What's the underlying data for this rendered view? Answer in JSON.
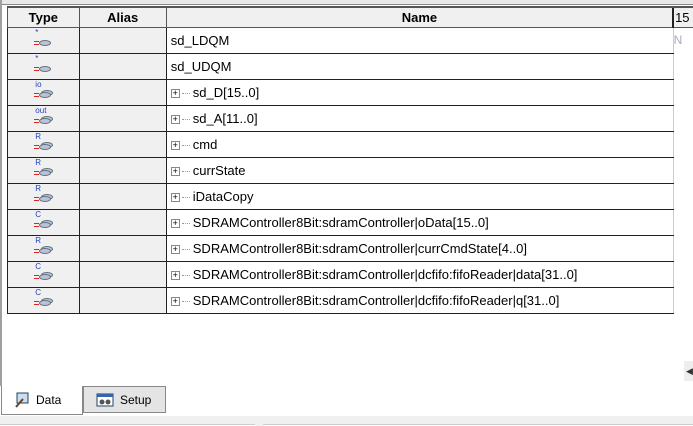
{
  "columns": {
    "type": "Type",
    "alias": "Alias",
    "name": "Name",
    "extra": "15"
  },
  "rows": [
    {
      "type_icon": "*",
      "icon_name": "single-node-icon",
      "name": "sd_LDQM",
      "expandable": false,
      "extra": "N"
    },
    {
      "type_icon": "*",
      "icon_name": "single-node-icon",
      "name": "sd_UDQM",
      "expandable": false,
      "extra": ""
    },
    {
      "type_icon": "io",
      "icon_name": "io-bus-icon",
      "name": "sd_D[15..0]",
      "expandable": true,
      "extra": ""
    },
    {
      "type_icon": "out",
      "icon_name": "output-bus-icon",
      "name": "sd_A[11..0]",
      "expandable": true,
      "extra": ""
    },
    {
      "type_icon": "R",
      "icon_name": "register-bus-icon",
      "name": "cmd",
      "expandable": true,
      "extra": ""
    },
    {
      "type_icon": "R",
      "icon_name": "register-bus-icon",
      "name": "currState",
      "expandable": true,
      "extra": ""
    },
    {
      "type_icon": "R",
      "icon_name": "register-bus-icon",
      "name": "iDataCopy",
      "expandable": true,
      "extra": ""
    },
    {
      "type_icon": "C",
      "icon_name": "combinational-bus-icon",
      "name": "SDRAMController8Bit:sdramController|oData[15..0]",
      "expandable": true,
      "extra": ""
    },
    {
      "type_icon": "R",
      "icon_name": "register-bus-icon",
      "name": "SDRAMController8Bit:sdramController|currCmdState[4..0]",
      "expandable": true,
      "extra": ""
    },
    {
      "type_icon": "C",
      "icon_name": "combinational-bus-icon",
      "name": "SDRAMController8Bit:sdramController|dcfifo:fifoReader|data[31..0]",
      "expandable": true,
      "extra": ""
    },
    {
      "type_icon": "C",
      "icon_name": "combinational-bus-icon",
      "name": "SDRAMController8Bit:sdramController|dcfifo:fifoReader|q[31..0]",
      "expandable": true,
      "extra": ""
    }
  ],
  "tabs": {
    "data": "Data",
    "setup": "Setup"
  }
}
